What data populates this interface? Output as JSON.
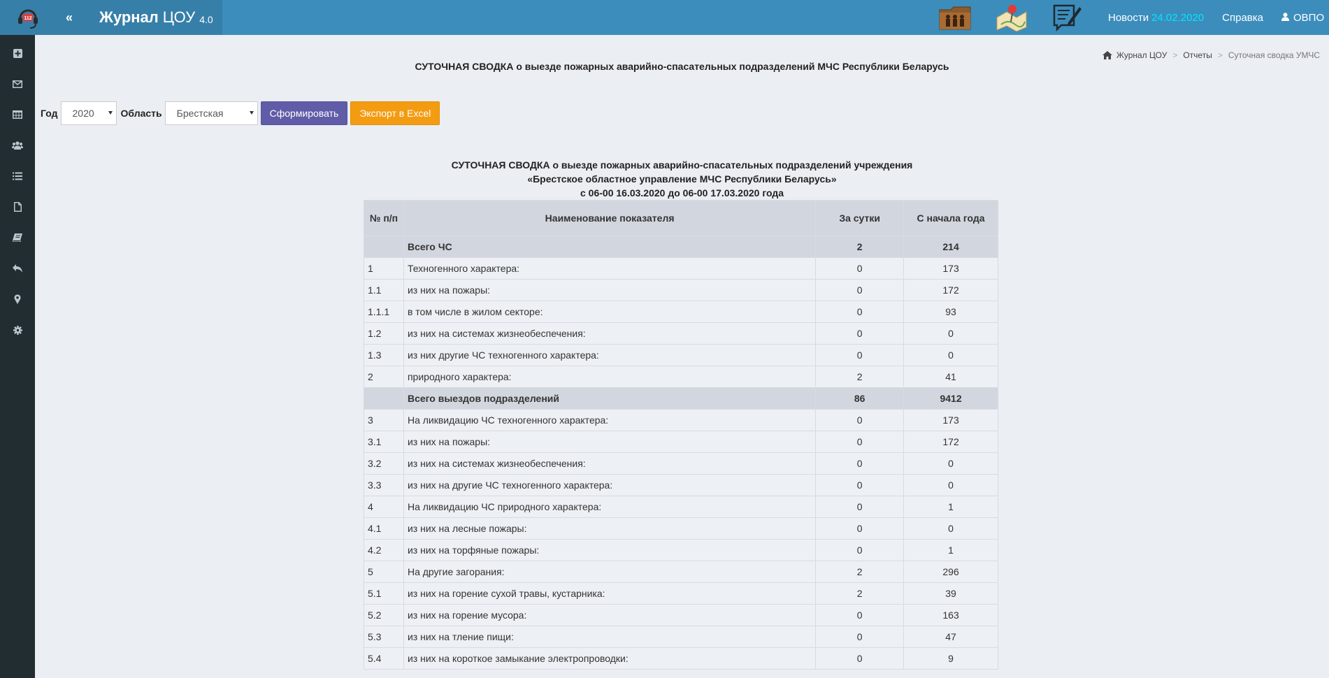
{
  "header": {
    "brand_bold": "Журнал",
    "brand_name": "ЦОУ",
    "brand_version": "4.0",
    "toggle": "«",
    "news_label": "Новости",
    "news_date": "24.02.2020",
    "help_label": "Справка",
    "user_label": "ОВПО",
    "logo_text": "112"
  },
  "breadcrumb": {
    "home": "Журнал ЦОУ",
    "reports": "Отчеты",
    "current": "Суточная сводка УМЧС",
    "sep": ">"
  },
  "page_title": "СУТОЧНАЯ СВОДКА о выезде пожарных аварийно-спасательных подразделений МЧС Республики Беларусь",
  "filters": {
    "year_label": "Год",
    "year_value": "2020",
    "region_label": "Область",
    "region_value": "Брестская",
    "generate_button": "Сформировать",
    "export_button": "Экспорт в Excel"
  },
  "report": {
    "line1": "СУТОЧНАЯ СВОДКА о выезде пожарных аварийно-спасательных подразделений учреждения",
    "line2": "«Брестское областное управление МЧС Республики Беларусь»",
    "line3": "с 06-00 16.03.2020 до 06-00 17.03.2020 года"
  },
  "table": {
    "headers": [
      "№ п/п",
      "Наименование показателя",
      "За сутки",
      "С начала года"
    ],
    "rows": [
      {
        "num": "",
        "name": "Всего ЧС",
        "day": "2",
        "year": "214",
        "group": true
      },
      {
        "num": "1",
        "name": "Техногенного характера:",
        "day": "0",
        "year": "173"
      },
      {
        "num": "1.1",
        "name": "из них на пожары:",
        "day": "0",
        "year": "172"
      },
      {
        "num": "1.1.1",
        "name": "в том числе в жилом секторе:",
        "day": "0",
        "year": "93"
      },
      {
        "num": "1.2",
        "name": "из них на системах жизнеобеспечения:",
        "day": "0",
        "year": "0"
      },
      {
        "num": "1.3",
        "name": "из них другие ЧС техногенного характера:",
        "day": "0",
        "year": "0"
      },
      {
        "num": "2",
        "name": "природного характера:",
        "day": "2",
        "year": "41"
      },
      {
        "num": "",
        "name": "Всего выездов подразделений",
        "day": "86",
        "year": "9412",
        "group": true
      },
      {
        "num": "3",
        "name": "На ликвидацию ЧС техногенного характера:",
        "day": "0",
        "year": "173"
      },
      {
        "num": "3.1",
        "name": "из них на пожары:",
        "day": "0",
        "year": "172"
      },
      {
        "num": "3.2",
        "name": "из них на системах жизнеобеспечения:",
        "day": "0",
        "year": "0"
      },
      {
        "num": "3.3",
        "name": "из них на другие ЧС техногенного характера:",
        "day": "0",
        "year": "0"
      },
      {
        "num": "4",
        "name": "На ликвидацию ЧС природного характера:",
        "day": "0",
        "year": "1"
      },
      {
        "num": "4.1",
        "name": "из них на лесные пожары:",
        "day": "0",
        "year": "0"
      },
      {
        "num": "4.2",
        "name": "из них на торфяные пожары:",
        "day": "0",
        "year": "1"
      },
      {
        "num": "5",
        "name": "На другие загорания:",
        "day": "2",
        "year": "296"
      },
      {
        "num": "5.1",
        "name": "из них на горение сухой травы, кустарника:",
        "day": "2",
        "year": "39"
      },
      {
        "num": "5.2",
        "name": "из них на горение мусора:",
        "day": "0",
        "year": "163"
      },
      {
        "num": "5.3",
        "name": "из них на тление пищи:",
        "day": "0",
        "year": "47"
      },
      {
        "num": "5.4",
        "name": "из них на короткое замыкание электропроводки:",
        "day": "0",
        "year": "9"
      }
    ]
  },
  "icons": {
    "sidebar": [
      "plus-square-icon",
      "envelope-icon",
      "table-icon",
      "users-icon",
      "list-icon",
      "file-icon",
      "book-icon",
      "reply-icon",
      "map-marker-icon",
      "gear-icon"
    ],
    "top": [
      "folder-people-icon",
      "map-pin-icon",
      "document-edit-icon"
    ]
  }
}
